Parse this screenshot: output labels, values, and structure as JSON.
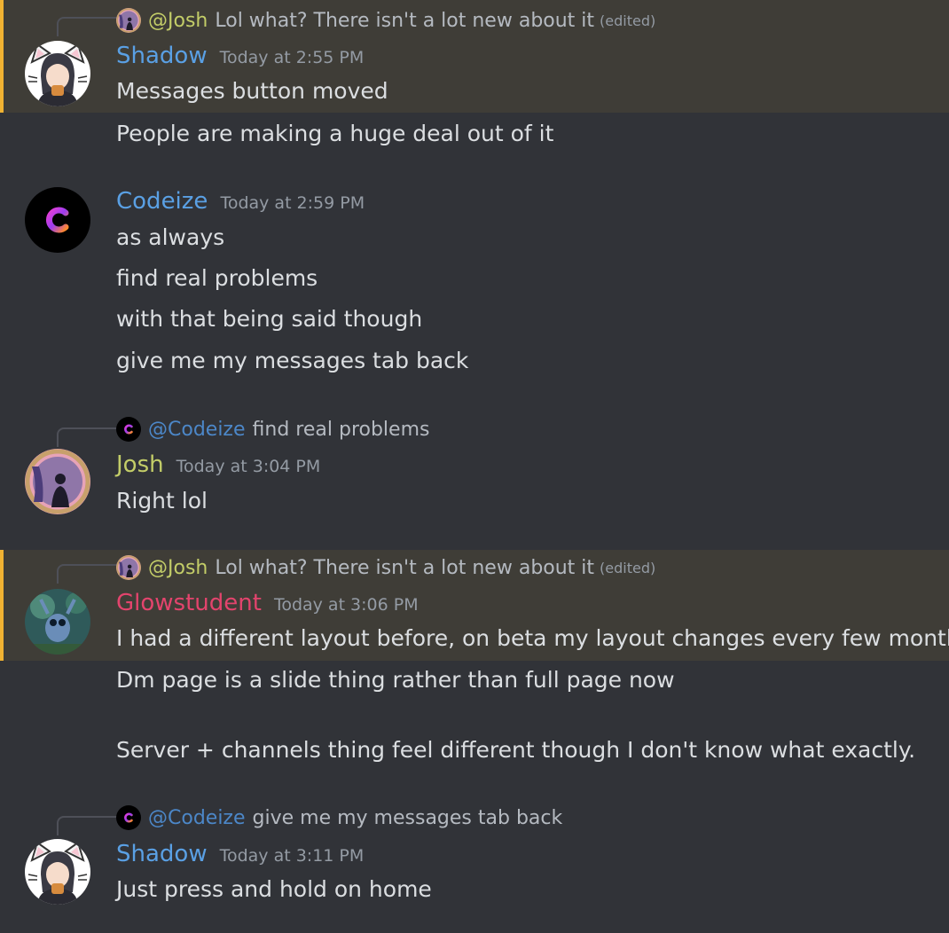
{
  "colors": {
    "background": "#313338",
    "highlight": "#3f3d37",
    "highlight_bar": "#f0b232",
    "shadow": "#5aa0e4",
    "codeize": "#5aa0e4",
    "josh": "#c3cd68",
    "glowstudent": "#e3446d",
    "mention_codeize": "#4c87c8"
  },
  "messages": [
    {
      "reply": {
        "mention": "@Josh",
        "text": "Lol what? There isn't a lot new about it",
        "edited": "(edited)"
      },
      "author": "Shadow",
      "time": "Today at 2:55 PM",
      "lines": [
        "Messages button moved",
        "People are making a huge deal out of it"
      ]
    },
    {
      "author": "Codeize",
      "time": "Today at 2:59 PM",
      "lines": [
        "as always",
        "find real problems",
        "with that being said though",
        "give me my messages tab back"
      ]
    },
    {
      "reply": {
        "mention": "@Codeize",
        "text": "find real problems"
      },
      "author": "Josh",
      "time": "Today at 3:04 PM",
      "lines": [
        "Right lol"
      ]
    },
    {
      "reply": {
        "mention": "@Josh",
        "text": "Lol what? There isn't a lot new about it",
        "edited": "(edited)"
      },
      "author": "Glowstudent",
      "time": "Today at 3:06 PM",
      "lines": [
        "I had a different layout before, on beta my layout changes every few months",
        "Dm page is a slide thing rather than full page now",
        "Server + channels thing feel different though I don't know what exactly."
      ]
    },
    {
      "reply": {
        "mention": "@Codeize",
        "text": "give me my messages tab back"
      },
      "author": "Shadow",
      "time": "Today at 3:11 PM",
      "lines": [
        "Just press and hold on home"
      ]
    }
  ]
}
